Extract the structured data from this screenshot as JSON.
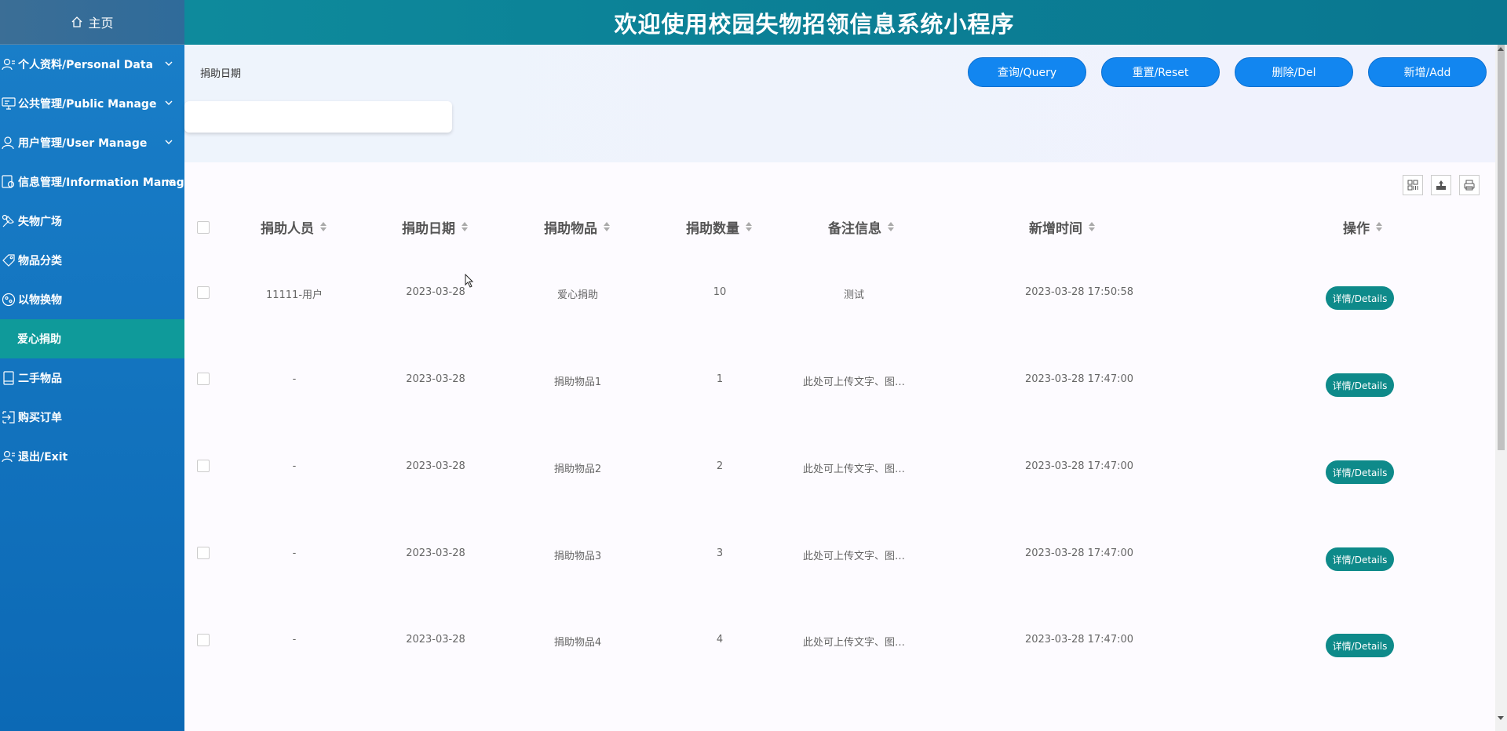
{
  "sidebar": {
    "home_label": "主页",
    "items": [
      {
        "label": "个人资料/Personal Data"
      },
      {
        "label": "公共管理/Public Manage"
      },
      {
        "label": "用户管理/User Manage"
      },
      {
        "label": "信息管理/Information Manage"
      },
      {
        "label": "失物广场"
      },
      {
        "label": "物品分类"
      },
      {
        "label": "以物换物"
      },
      {
        "label": "爱心捐助"
      },
      {
        "label": "二手物品"
      },
      {
        "label": "购买订单"
      },
      {
        "label": "退出/Exit"
      }
    ]
  },
  "header": {
    "title": "欢迎使用校园失物招领信息系统小程序"
  },
  "search": {
    "label": "捐助日期",
    "value": "",
    "query_label": "查询/Query",
    "reset_label": "重置/Reset",
    "delete_label": "删除/Del",
    "add_label": "新增/Add"
  },
  "table": {
    "columns": [
      "捐助人员",
      "捐助日期",
      "捐助物品",
      "捐助数量",
      "备注信息",
      "新增时间",
      "操作"
    ],
    "rows": [
      {
        "person": "11111-用户",
        "date": "2023-03-28",
        "item": "爱心捐助",
        "qty": "10",
        "note": "测试",
        "time": "2023-03-28 17:50:58",
        "action": "详情/Details"
      },
      {
        "person": "-",
        "date": "2023-03-28",
        "item": "捐助物品1",
        "qty": "1",
        "note": "此处可上传文字、图…",
        "time": "2023-03-28 17:47:00",
        "action": "详情/Details"
      },
      {
        "person": "-",
        "date": "2023-03-28",
        "item": "捐助物品2",
        "qty": "2",
        "note": "此处可上传文字、图…",
        "time": "2023-03-28 17:47:00",
        "action": "详情/Details"
      },
      {
        "person": "-",
        "date": "2023-03-28",
        "item": "捐助物品3",
        "qty": "3",
        "note": "此处可上传文字、图…",
        "time": "2023-03-28 17:47:00",
        "action": "详情/Details"
      },
      {
        "person": "-",
        "date": "2023-03-28",
        "item": "捐助物品4",
        "qty": "4",
        "note": "此处可上传文字、图…",
        "time": "2023-03-28 17:47:00",
        "action": "详情/Details"
      }
    ]
  },
  "colors": {
    "sidebar_bg": "#1a7fc9",
    "active_item": "#0f9a9a",
    "header_bg": "#0e8a9c",
    "button_blue": "#1286f0",
    "details_button": "#0e8a8a"
  }
}
